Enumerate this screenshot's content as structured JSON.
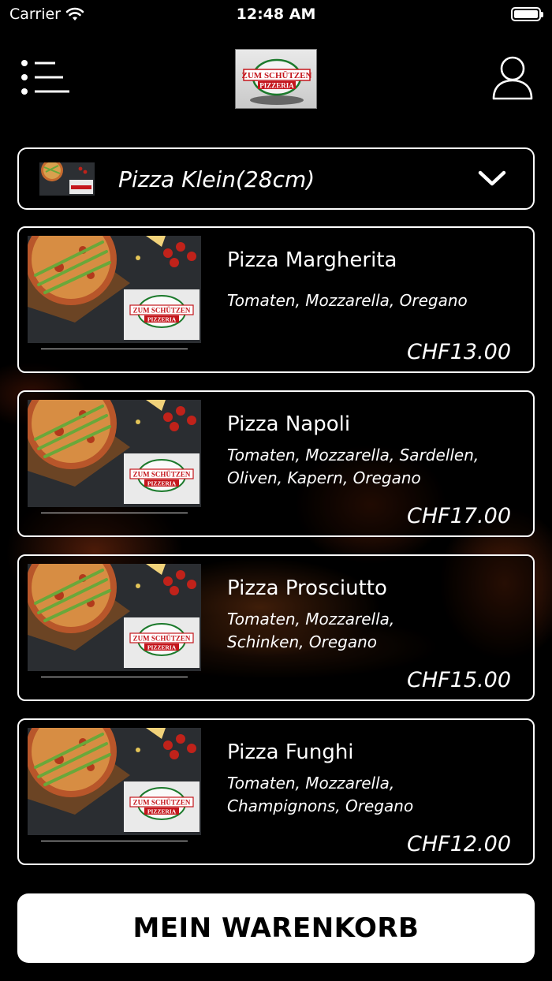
{
  "status_bar": {
    "carrier": "Carrier",
    "time": "12:48 AM"
  },
  "header": {
    "logo_line1": "ZUM SCHÜTZEN",
    "logo_line2": "PIZZERIA",
    "menu_icon": "hamburger-menu-icon",
    "user_icon": "user-profile-icon"
  },
  "category": {
    "selected": "Pizza Klein(28cm)",
    "icon": "chevron-down-icon"
  },
  "products": [
    {
      "name": "Pizza Margherita",
      "description": "Tomaten, Mozzarella, Oregano",
      "price": "CHF13.00"
    },
    {
      "name": "Pizza Napoli",
      "description": "Tomaten, Mozzarella, Sardellen, Oliven, Kapern, Oregano",
      "price": "CHF17.00"
    },
    {
      "name": "Pizza Prosciutto",
      "description": "Tomaten, Mozzarella, Schinken, Oregano",
      "price": "CHF15.00"
    },
    {
      "name": "Pizza Funghi",
      "description": "Tomaten, Mozzarella, Champignons, Oregano",
      "price": "CHF12.00"
    }
  ],
  "cart": {
    "label": "MEIN WARENKORB"
  },
  "colors": {
    "background": "#000000",
    "logo_red": "#c4161c",
    "logo_green": "#1c7a2c",
    "fire_orange": "#ff7a28"
  }
}
